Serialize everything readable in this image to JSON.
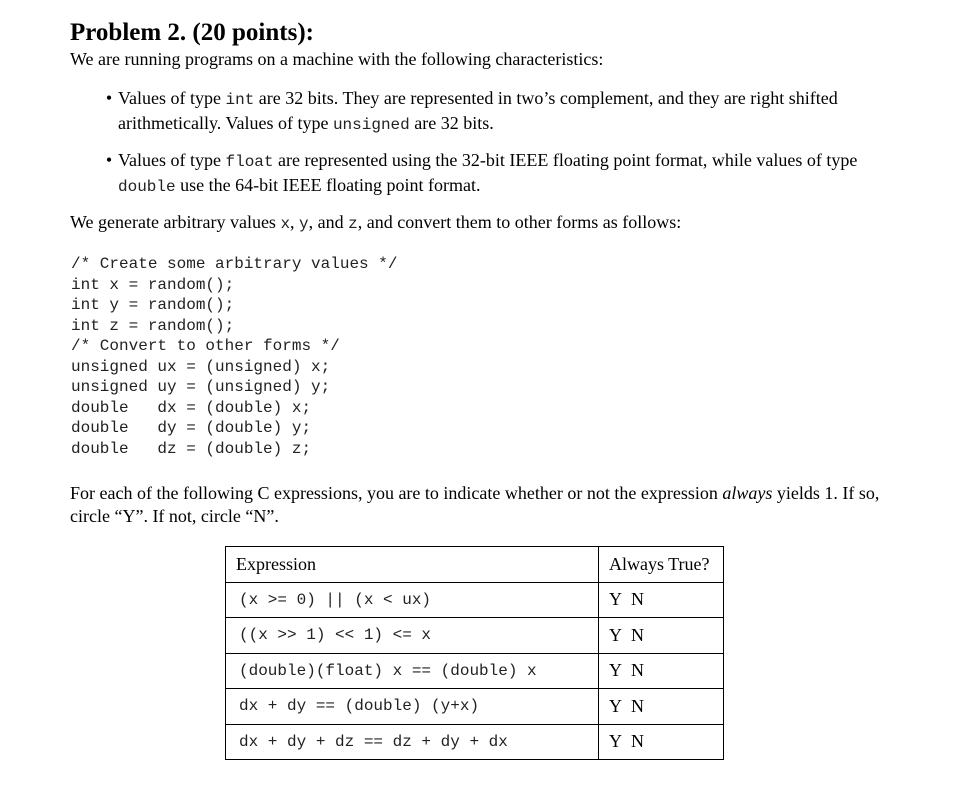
{
  "problem": {
    "title": "Problem 2. (20 points):",
    "intro": "We are running programs on a machine with the following characteristics:"
  },
  "bullets": [
    {
      "parts": [
        "Values of type ",
        "int",
        " are 32 bits. They are represented in two’s complement, and they are right shifted arithmetically. Values of type ",
        "unsigned",
        " are 32 bits."
      ]
    },
    {
      "parts": [
        "Values of type ",
        "float",
        " are represented using the 32-bit IEEE floating point format, while values of type ",
        "double",
        " use the 64-bit IEEE floating point format."
      ]
    }
  ],
  "generate_text": {
    "parts": [
      "We generate arbitrary values ",
      "x",
      ", ",
      "y",
      ", and ",
      "z",
      ", and convert them to other forms as follows:"
    ]
  },
  "code_lines": [
    "/* Create some arbitrary values */",
    "int x = random();",
    "int y = random();",
    "int z = random();",
    "/* Convert to other forms */",
    "unsigned ux = (unsigned) x;",
    "unsigned uy = (unsigned) y;",
    "double   dx = (double) x;",
    "double   dy = (double) y;",
    "double   dz = (double) z;"
  ],
  "instructions": {
    "before_italic": "For each of the following C expressions, you are to indicate whether or not the expression ",
    "italic": "always",
    "after_italic": " yields 1. If so, circle “Y”. If not, circle “N”."
  },
  "table": {
    "headers": [
      "Expression",
      "Always True?"
    ],
    "rows": [
      {
        "expression": "(x >= 0) || (x < ux)",
        "yes": "Y",
        "no": "N"
      },
      {
        "expression": "((x >> 1) << 1) <= x",
        "yes": "Y",
        "no": "N"
      },
      {
        "expression": "(double)(float) x == (double) x",
        "yes": "Y",
        "no": "N"
      },
      {
        "expression": "dx + dy == (double) (y+x)",
        "yes": "Y",
        "no": "N"
      },
      {
        "expression": "dx + dy + dz == dz + dy + dx",
        "yes": "Y",
        "no": "N"
      }
    ]
  }
}
